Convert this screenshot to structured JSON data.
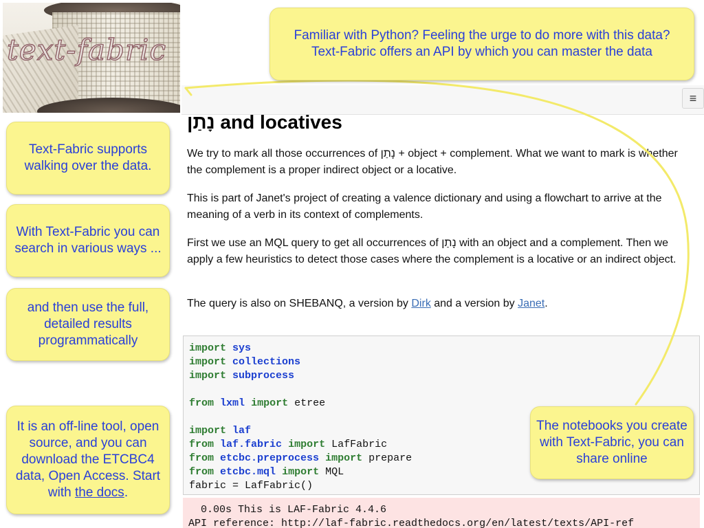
{
  "logo": {
    "text": "text-fabric"
  },
  "callouts": {
    "top": "Familiar with Python? Feeling the urge to do more with this data? Text-Fabric offers an API by which you can master the data",
    "walk": "Text-Fabric supports walking over the data.",
    "search": "With Text-Fabric you can search in various ways ...",
    "results": "and then use the full, detailed results programmatically",
    "offline_pre": "It is an off-line tool, open source, and you can download the ETCBC4 data, Open Access. Start with ",
    "offline_link": "the docs",
    "offline_post": ".",
    "share": "The notebooks you create with Text-Fabric, you can share online"
  },
  "notebook": {
    "menu_icon": "≡",
    "title": "נָתַן and locatives",
    "p1": "We try to mark all those occurrences of נָתַן + object + complement. What we want to mark is whether the complement is a proper indirect object or a locative.",
    "p2": "This is part of Janet's project of creating a valence dictionary and using a flowchart to arrive at the meaning of a verb in its context of complements.",
    "p3": "First we use an MQL query to get all occurrences of נָתַן with an object and a complement. Then we apply a few heuristics to detect those cases where the complement is a locative or an indirect object.",
    "p4_pre": "The query is also on SHEBANQ, a version by ",
    "p4_link1": "Dirk",
    "p4_mid": " and a version by ",
    "p4_link2": "Janet",
    "p4_post": ".",
    "code": {
      "l1_kw": "import",
      "l1_mod": "sys",
      "l2_kw": "import",
      "l2_mod": "collections",
      "l3_kw": "import",
      "l3_mod": "subprocess",
      "l5_kw1": "from",
      "l5_mod": "lxml",
      "l5_kw2": "import",
      "l5_rest": " etree",
      "l7_kw": "import",
      "l7_mod": "laf",
      "l8_kw1": "from",
      "l8_mod": "laf.fabric",
      "l8_kw2": "import",
      "l8_rest": " LafFabric",
      "l9_kw1": "from",
      "l9_mod": "etcbc.preprocess",
      "l9_kw2": "import",
      "l9_rest": " prepare",
      "l10_kw1": "from",
      "l10_mod": "etcbc.mql",
      "l10_kw2": "import",
      "l10_rest": " MQL",
      "l11": "fabric = LafFabric()"
    },
    "output": {
      "line1": "  0.00s This is LAF-Fabric 4.4.6",
      "line2": "API reference: http://laf-fabric.readthedocs.org/en/latest/texts/API-ref"
    }
  },
  "colors": {
    "callout_bg": "#fbf58f",
    "callout_text": "#2a40d8",
    "arc": "#f3ea6a",
    "keyword": "#2f7d32",
    "module": "#1b3fd0",
    "output_bg": "#fde3e3"
  }
}
